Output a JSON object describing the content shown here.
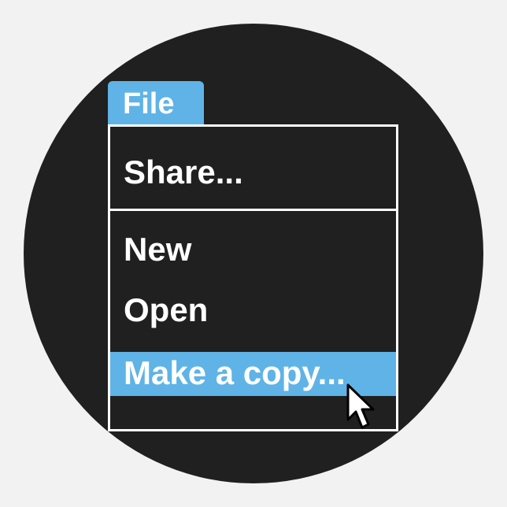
{
  "colors": {
    "background": "#202020",
    "accent": "#5fb3e6",
    "text": "#ffffff"
  },
  "menu": {
    "title": "File",
    "items": [
      {
        "label": "Share...",
        "highlighted": false
      },
      {
        "label": "New",
        "highlighted": false
      },
      {
        "label": "Open",
        "highlighted": false
      },
      {
        "label": "Make a copy...",
        "highlighted": true
      }
    ]
  },
  "cursor": {
    "icon": "arrow-pointer-icon"
  }
}
